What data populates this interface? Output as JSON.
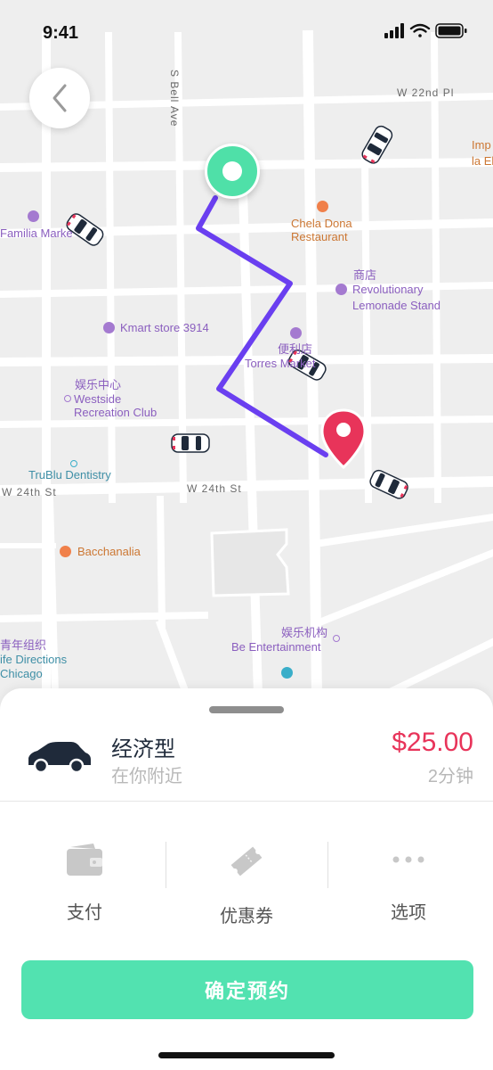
{
  "status_bar": {
    "time": "9:41"
  },
  "map": {
    "streets": [
      "S Bell Ave",
      "W 22nd Pl",
      "W 24th St",
      "W 24th St"
    ],
    "places": [
      {
        "name": "Familia Market",
        "label": "Familia Marke"
      },
      {
        "name": "Chela Dona Restaurant",
        "line1": "Chela Dona",
        "line2": "Restaurant"
      },
      {
        "name": "Revolutionary Lemonade Stand",
        "zh": "商店",
        "line1": "Revolutionary",
        "line2": "Lemonade Stand"
      },
      {
        "name": "Kmart store 3914",
        "label": "Kmart store 3914"
      },
      {
        "name": "Torres Market",
        "zh": "便利店",
        "label": "Torres Market"
      },
      {
        "name": "Westside Recreation Club",
        "zh": "娱乐中心",
        "line1": "Westside",
        "line2": "Recreation Club"
      },
      {
        "name": "TruBlu Dentistry",
        "label": "TruBlu Dentistry"
      },
      {
        "name": "Bacchanalia",
        "label": "Bacchanalia"
      },
      {
        "name": "Be Entertainment",
        "zh": "娱乐机构",
        "label": "Be Entertainment"
      },
      {
        "name": "Life Directions Chicago",
        "zh": "青年组织",
        "line1": "ife Directions",
        "line2": "Chicago"
      },
      {
        "name": "Imp la El (cut)",
        "line1": "Imp",
        "line2": "la El"
      }
    ]
  },
  "ride": {
    "type": "经济型",
    "availability": "在你附近",
    "price": "$25.00",
    "eta": "2分钟"
  },
  "options": [
    {
      "label": "支付",
      "icon": "wallet-icon"
    },
    {
      "label": "优惠券",
      "icon": "coupon-icon"
    },
    {
      "label": "选项",
      "icon": "more-dots-icon"
    }
  ],
  "confirm_label": "确定预约",
  "colors": {
    "route": "#6a3ff0",
    "pickup": "#4fe0a8",
    "destination": "#e8345a",
    "confirm": "#52e2b0",
    "price": "#e8345a"
  }
}
